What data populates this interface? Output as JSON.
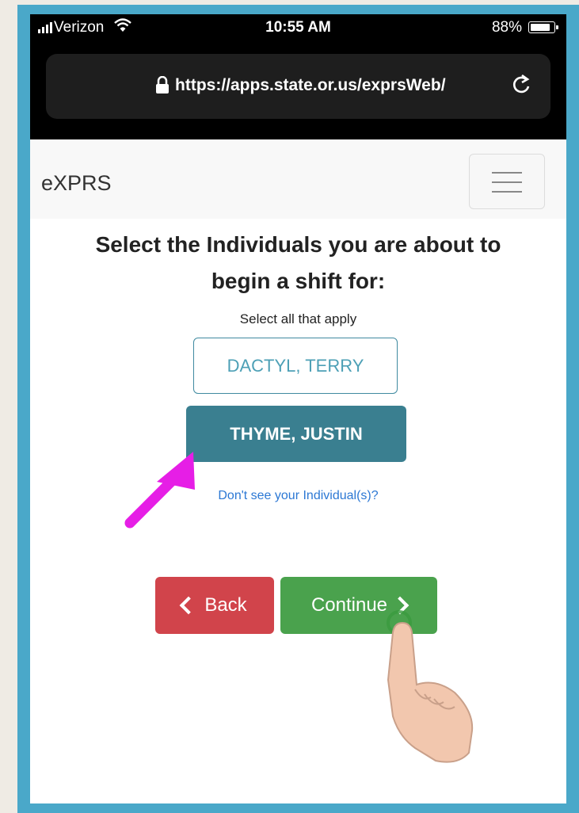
{
  "status_bar": {
    "carrier": "Verizon",
    "time": "10:55 AM",
    "battery_percent": "88%",
    "battery_level": 0.88
  },
  "browser": {
    "url": "https://apps.state.or.us/exprsWeb/"
  },
  "navbar": {
    "brand": "eXPRS"
  },
  "page": {
    "heading_line1": "Select the Individuals you are about to",
    "heading_line2": "begin a shift for:",
    "subtext": "Select all that apply",
    "individuals": [
      {
        "label": "DACTYL, TERRY",
        "selected": false
      },
      {
        "label": "THYME, JUSTIN",
        "selected": true
      }
    ],
    "help_link": "Don't see your Individual(s)?",
    "back_label": "Back",
    "continue_label": "Continue"
  },
  "colors": {
    "frame": "#4aa8c9",
    "selected_individual": "#3a7f90",
    "back_button": "#d1444b",
    "continue_button": "#4aa24d",
    "annotation_arrow": "#e61ee6"
  }
}
